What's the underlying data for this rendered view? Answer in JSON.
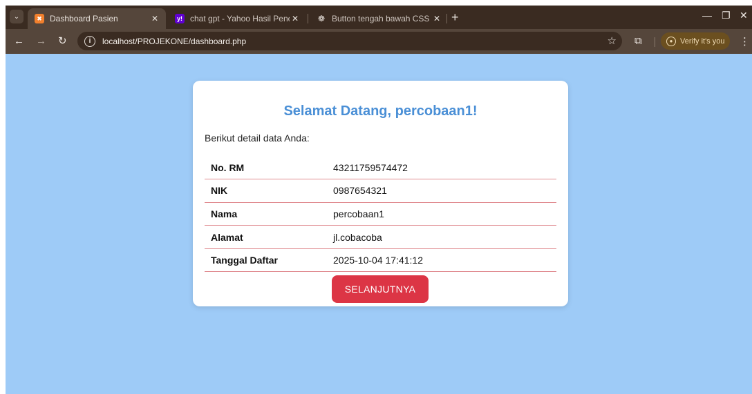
{
  "browser": {
    "tabs": [
      {
        "title": "Dashboard Pasien",
        "favicon": "xampp-icon",
        "active": true
      },
      {
        "title": "chat gpt - Yahoo Hasil Pencarian",
        "favicon": "yahoo-icon",
        "active": false
      },
      {
        "title": "Button tengah bawah CSS",
        "favicon": "chatgpt-icon",
        "active": false
      }
    ],
    "url": "localhost/PROJEKONE/dashboard.php",
    "verify_label": "Verify it's you",
    "colors": {
      "tabstrip": "#3a2b21",
      "toolbar": "#55463b",
      "page_bg": "#9ecbf7"
    }
  },
  "card": {
    "heading": "Selamat Datang, percobaan1!",
    "intro": "Berikut detail data Anda:",
    "rows": [
      {
        "label": "No. RM",
        "value": "43211759574472"
      },
      {
        "label": "NIK",
        "value": "0987654321"
      },
      {
        "label": "Nama",
        "value": "percobaan1"
      },
      {
        "label": "Alamat",
        "value": "jl.cobacoba"
      },
      {
        "label": "Tanggal Daftar",
        "value": "2025-10-04 17:41:12"
      }
    ],
    "button_label": "SELANJUTNYA",
    "colors": {
      "heading": "#4a8fd6",
      "button": "#dc3545",
      "row_border": "#e08a8f"
    }
  }
}
